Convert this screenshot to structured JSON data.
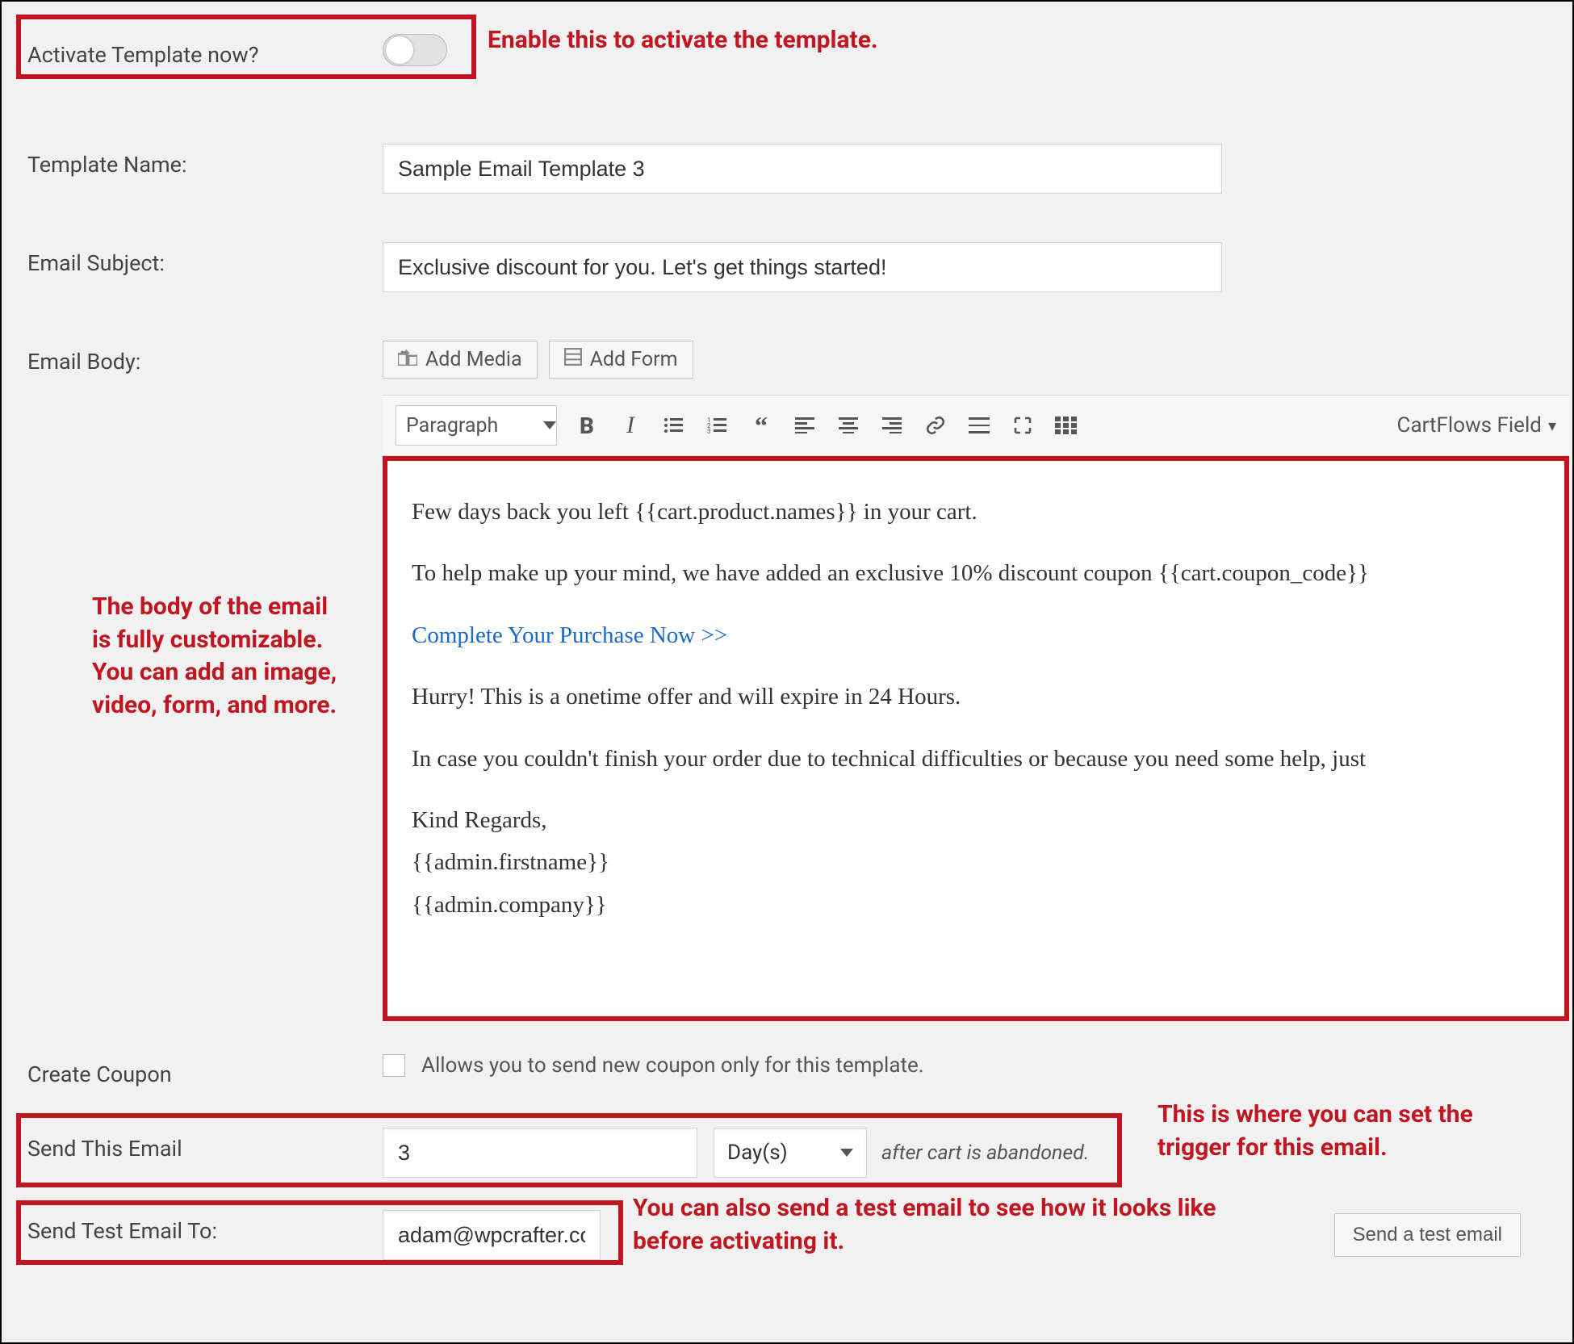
{
  "activate": {
    "label": "Activate Template now?"
  },
  "annotations": {
    "activate": "Enable this to activate the template.",
    "body": "The body of the email is fully customizable. You can add an image, video, form, and more.",
    "trigger": "This is where you can set the trigger for this email.",
    "test": "You can also send a test email to see how it looks like before activating it."
  },
  "templateName": {
    "label": "Template Name:",
    "value": "Sample Email Template 3"
  },
  "subject": {
    "label": "Email Subject:",
    "value": "Exclusive discount for you. Let's get things started!"
  },
  "body": {
    "label": "Email Body:",
    "addMedia": "Add Media",
    "addForm": "Add Form",
    "formatSelect": "Paragraph",
    "cfField": "CartFlows Field",
    "content": {
      "p1": "Few days back you left {{cart.product.names}} in your cart.",
      "p2": "To help make up your mind, we have added an exclusive 10% discount coupon {{cart.coupon_code}}",
      "link": "Complete Your Purchase Now >>",
      "p3": "Hurry! This is a onetime offer and will expire in 24 Hours.",
      "p4": "In case you couldn't finish your order due to technical difficulties or because you need some help, just",
      "p5a": "Kind Regards,",
      "p5b": "{{admin.firstname}}",
      "p5c": "{{admin.company}}"
    }
  },
  "coupon": {
    "label": "Create Coupon",
    "desc": "Allows you to send new coupon only for this template."
  },
  "sendEmail": {
    "label": "Send This Email",
    "value": "3",
    "unit": "Day(s)",
    "after": "after cart is abandoned."
  },
  "testEmail": {
    "label": "Send Test Email To:",
    "value": "adam@wpcrafter.com",
    "button": "Send a test email"
  }
}
